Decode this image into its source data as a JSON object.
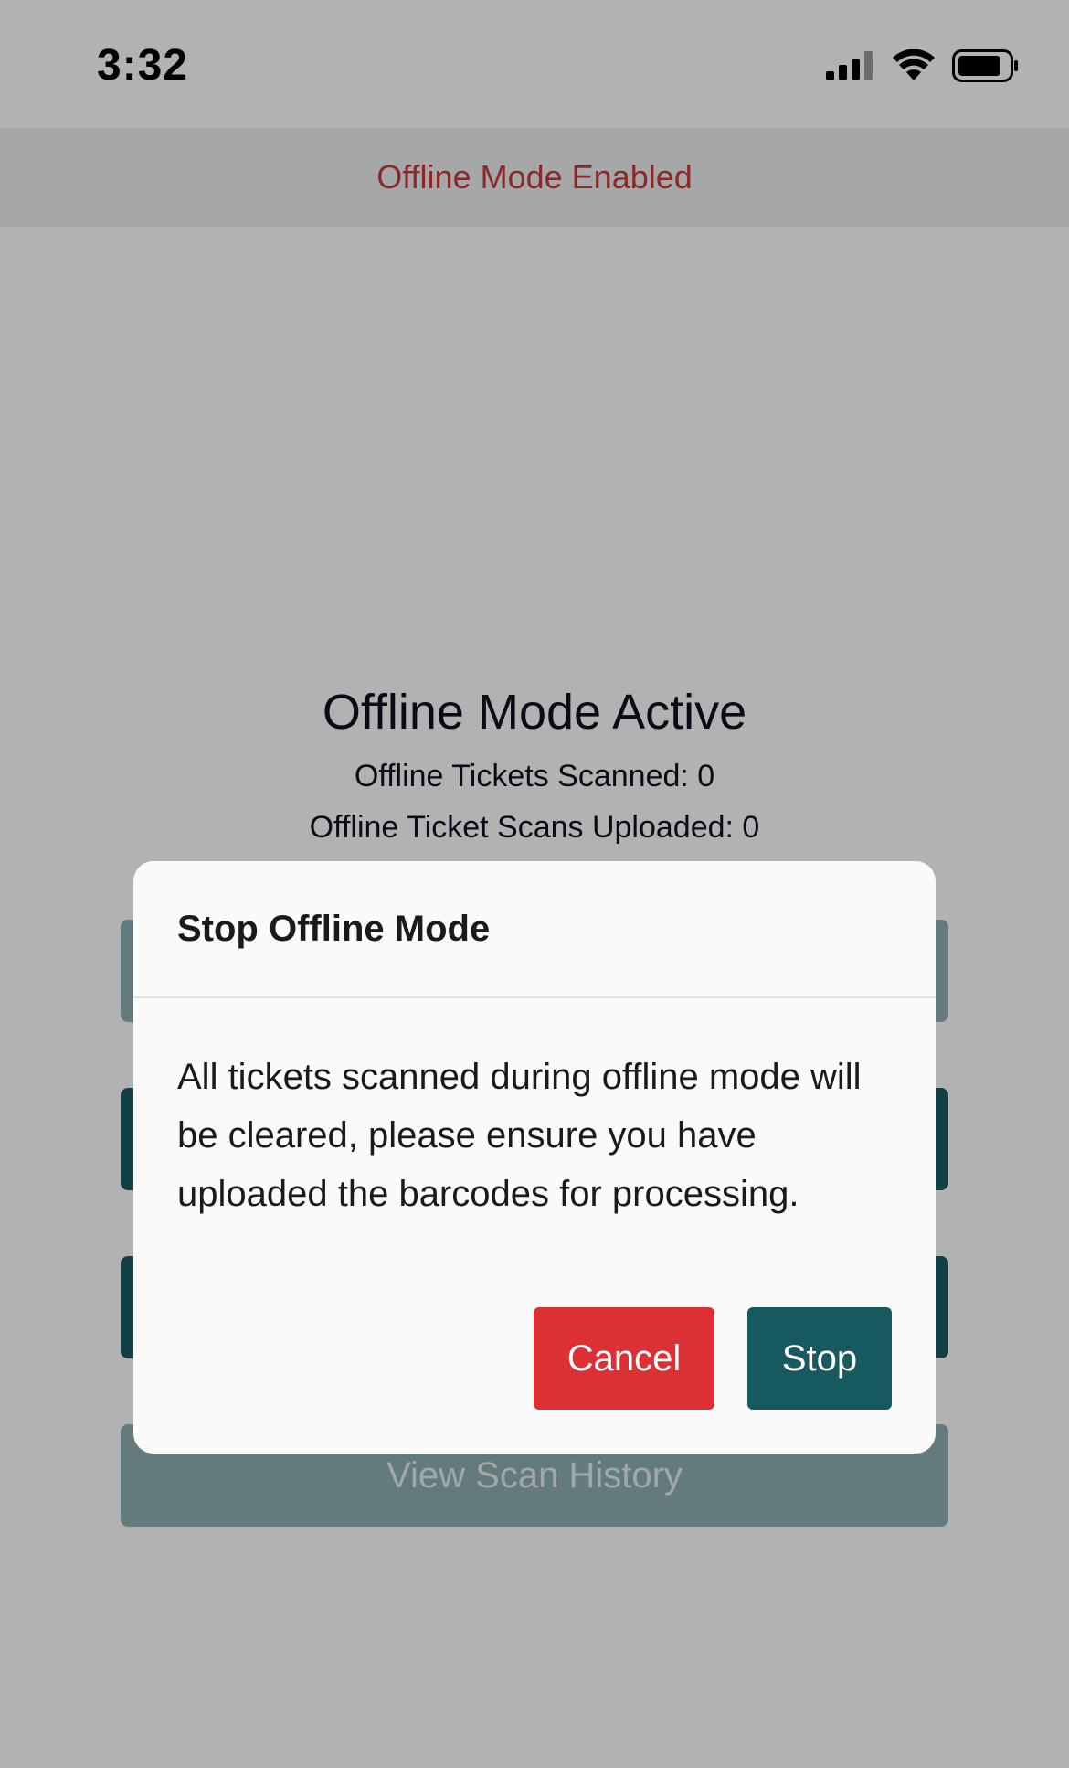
{
  "status_bar": {
    "time": "3:32"
  },
  "banner": {
    "text": "Offline Mode Enabled",
    "color": "#c83c3c"
  },
  "main": {
    "title": "Offline Mode Active",
    "tickets_scanned": "Offline Tickets Scanned: 0",
    "scans_uploaded": "Offline Ticket Scans Uploaded: 0",
    "history_button": "View Scan History"
  },
  "dialog": {
    "title": "Stop Offline Mode",
    "message": "All tickets scanned during offline mode will be cleared, please ensure you have uploaded the barcodes for processing.",
    "cancel_label": "Cancel",
    "stop_label": "Stop",
    "cancel_color": "#dc3035",
    "stop_color": "#165a60"
  },
  "icons": [
    "cellular-signal-icon",
    "wifi-icon",
    "battery-icon"
  ]
}
